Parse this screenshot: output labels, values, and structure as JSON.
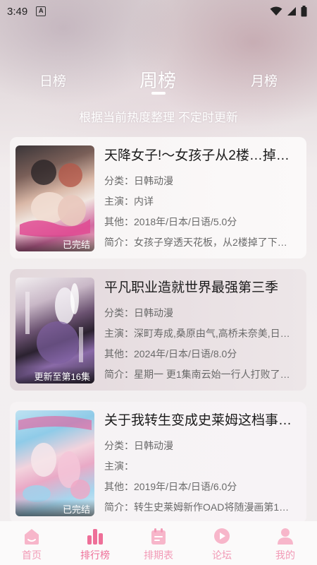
{
  "status_bar": {
    "time": "3:49",
    "notification_badge": "A"
  },
  "tabs": {
    "items": [
      {
        "label": "日榜",
        "active": false
      },
      {
        "label": "周榜",
        "active": true
      },
      {
        "label": "月榜",
        "active": false
      }
    ]
  },
  "subtitle": "根据当前热度整理 不定时更新",
  "list": [
    {
      "title": "天降女子!～女孩子从2楼…掉…",
      "category": "分类：日韩动漫",
      "cast": "主演：内详",
      "other": "其他：2018年/日本/日语/5.0分",
      "synopsis": "简介：女孩子穿透天花板，从2楼掉了下…",
      "badge": "已完结"
    },
    {
      "title": "平凡职业造就世界最强第三季",
      "category": "分类：日韩动漫",
      "cast": "主演：深町寿成,桑原由气,高桥未奈美,日…",
      "other": "其他：2024年/日本/日语/8.0分",
      "synopsis": "简介：星期一 更1集南云始一行人打败了…",
      "badge": "更新至第16集"
    },
    {
      "title": "关于我转生变成史莱姆这档事…",
      "category": "分类：日韩动漫",
      "cast": "主演：",
      "other": "其他：2019年/日本/日语/6.0分",
      "synopsis": "简介：转生史莱姆新作OAD将随漫画第1…",
      "badge": "已完结"
    }
  ],
  "bottom_nav": [
    {
      "label": "首页",
      "icon": "home-icon"
    },
    {
      "label": "排行榜",
      "icon": "rank-icon",
      "active": true
    },
    {
      "label": "排期表",
      "icon": "schedule-icon"
    },
    {
      "label": "论坛",
      "icon": "forum-icon"
    },
    {
      "label": "我的",
      "icon": "profile-icon"
    }
  ],
  "colors": {
    "accent": "#ee6f98",
    "nav_inactive": "#f29ab6"
  }
}
